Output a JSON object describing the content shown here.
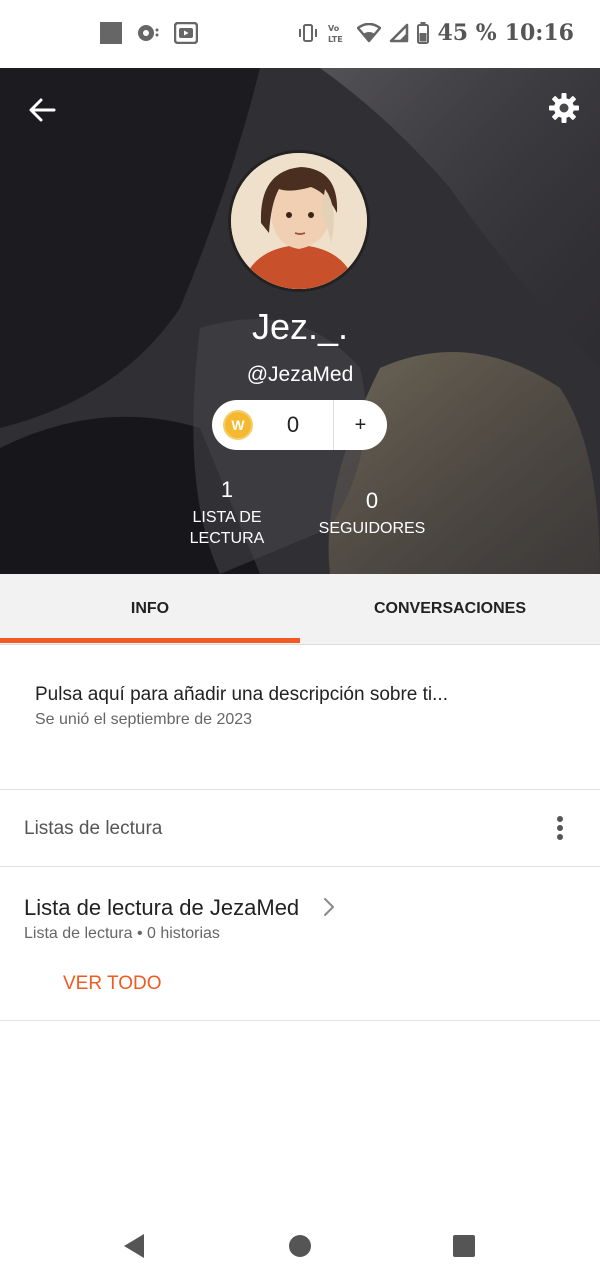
{
  "status_bar": {
    "battery": "45 %",
    "time": "10:16",
    "icons": [
      "notification-square-icon",
      "cast-icon",
      "youtube-icon",
      "vibrate-icon",
      "volte-icon",
      "wifi-icon",
      "signal-icon",
      "battery-icon"
    ]
  },
  "profile": {
    "display_name": "Jez._.",
    "username": "@JezaMed",
    "coins": "0",
    "add_label": "+",
    "reading_lists_count": "1",
    "reading_lists_label_line1": "LISTA DE",
    "reading_lists_label_line2": "LECTURA",
    "followers_count": "0",
    "followers_label": "SEGUIDORES"
  },
  "tabs": [
    {
      "label": "INFO",
      "active": true
    },
    {
      "label": "CONVERSACIONES",
      "active": false
    }
  ],
  "info": {
    "description_prompt": "Pulsa aquí para añadir una descripción sobre ti...",
    "joined": "Se unió el septiembre de 2023"
  },
  "reading_lists": {
    "section_title": "Listas de lectura",
    "items": [
      {
        "title": "Lista de lectura de JezaMed",
        "meta": "Lista de lectura • 0 historias"
      }
    ],
    "see_all": "VER TODO"
  },
  "colors": {
    "accent": "#f15a22",
    "coin": "#f5b82e"
  }
}
